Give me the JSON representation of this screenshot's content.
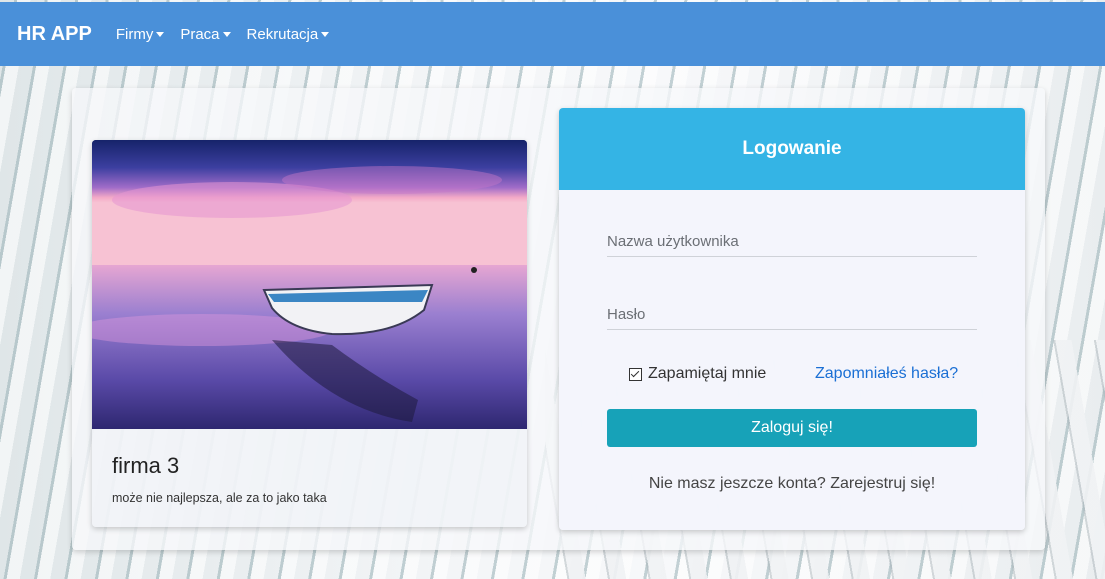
{
  "nav": {
    "brand": "HR APP",
    "items": [
      {
        "label": "Firmy"
      },
      {
        "label": "Praca"
      },
      {
        "label": "Rekrutacja"
      }
    ]
  },
  "company_card": {
    "title": "firma 3",
    "subtitle": "może nie najlepsza, ale za to jako taka"
  },
  "login": {
    "header": "Logowanie",
    "username_placeholder": "Nazwa użytkownika",
    "password_placeholder": "Hasło",
    "remember_label": "Zapamiętaj mnie",
    "remember_checked": true,
    "forgot_label": "Zapomniałeś hasła?",
    "submit_label": "Zaloguj się!",
    "register_text": "Nie masz jeszcze konta? Zarejestruj się!"
  },
  "colors": {
    "navbar": "#4a90d9",
    "login_header": "#34b4e5",
    "submit_button": "#17a2b8",
    "link": "#1a6fd4"
  }
}
